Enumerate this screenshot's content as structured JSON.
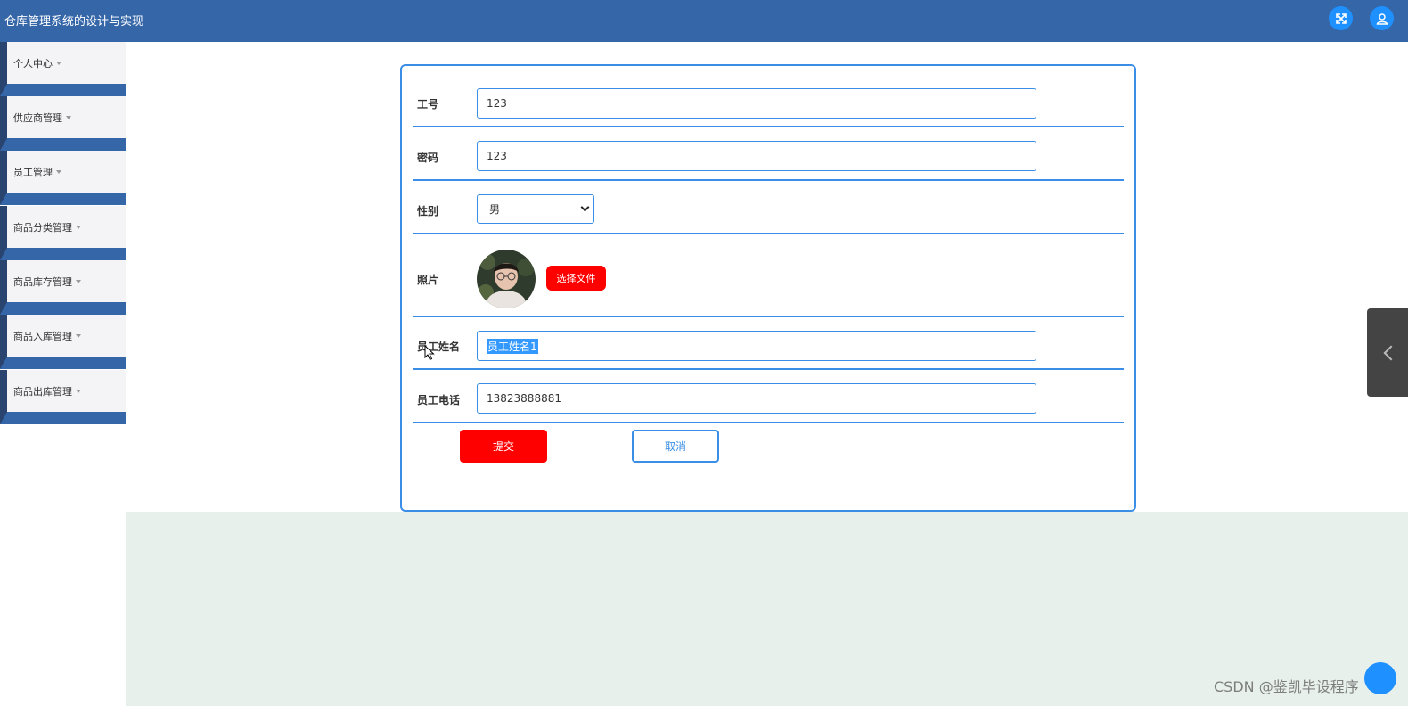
{
  "header": {
    "title": "仓库管理系统的设计与实现",
    "icons": [
      "fullscreen-icon",
      "user-icon"
    ]
  },
  "sidebar": {
    "items": [
      {
        "label": "个人中心"
      },
      {
        "label": "供应商管理"
      },
      {
        "label": "员工管理"
      },
      {
        "label": "商品分类管理"
      },
      {
        "label": "商品库存管理"
      },
      {
        "label": "商品入库管理"
      },
      {
        "label": "商品出库管理"
      }
    ]
  },
  "form": {
    "fields": {
      "employee_id": {
        "label": "工号",
        "value": "123"
      },
      "password": {
        "label": "密码",
        "value": "123"
      },
      "gender": {
        "label": "性别",
        "value": "男"
      },
      "photo": {
        "label": "照片",
        "button": "选择文件"
      },
      "name": {
        "label": "员工姓名",
        "value": "员工姓名1"
      },
      "phone": {
        "label": "员工电话",
        "value": "13823888881"
      }
    },
    "submit_label": "提交",
    "cancel_label": "取消"
  },
  "watermark": "CSDN @鉴凯毕设程序",
  "colors": {
    "header": "#3566a8",
    "accent": "#3a8ee6",
    "danger": "#ff0000",
    "pale": "#e8f0ec"
  }
}
